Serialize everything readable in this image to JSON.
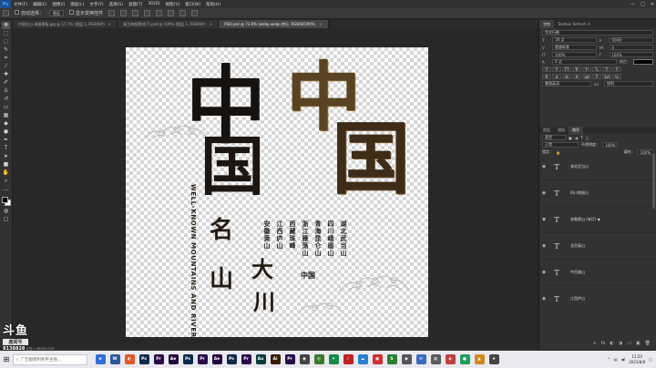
{
  "menubar": {
    "logo": "Ps",
    "items": [
      "文件(F)",
      "编辑(E)",
      "图像(I)",
      "图层(L)",
      "文字(Y)",
      "选择(S)",
      "滤镜(T)",
      "3D(D)",
      "视图(V)",
      "窗口(W)",
      "帮助(H)"
    ],
    "controls": [
      "—",
      "□",
      "✕"
    ]
  },
  "options": {
    "auto_select": "自动选择：",
    "group": "图层",
    "show_transform": "显示变换控件"
  },
  "tabs": [
    {
      "label": "中国名山-海报模板.jpg @ 17.7% (图层 1, RGB/8#)",
      "active": false
    },
    {
      "label": "复古海报素材(7).psd @ 100% (图层 1, RGB/8#)",
      "active": false
    },
    {
      "label": "PSD.psd @ 73.6% (webp.webp 拷贝, RGB/8/CMYK)",
      "active": true
    }
  ],
  "canvas": {
    "zhong_dark": "中",
    "guo_dark": "国",
    "zhong_gold": "中",
    "guo_gold": "国",
    "ming": "名",
    "shan": "山",
    "da": "大",
    "chuan": "川",
    "seal": "中国",
    "english": "WELL-KNOWN MOUNTAINS AND RIVERS",
    "columns": [
      "湖北武当山",
      "四川峨眉山",
      "青海昆仑山",
      "浙江雁荡山",
      "西藏珠峰",
      "江西庐山",
      "安徽黄山"
    ]
  },
  "character_panel": {
    "tabs": [
      "字符",
      "Textbox Refresh 4"
    ],
    "font": "华文行楷",
    "size": "18 点",
    "leading": "(自动)",
    "kerning": "度量标准",
    "tracking": "0",
    "scale_v": "100%",
    "scale_h": "100%",
    "baseline": "0 点",
    "color_label": "颜色：",
    "language": "美国英语",
    "antialias": "锐利",
    "style_buttons": [
      "T",
      "T",
      "TT",
      "Tr",
      "T¹",
      "T₁",
      "T",
      "T"
    ]
  },
  "layers_panel": {
    "tabs": [
      "图层",
      "通道",
      "路径"
    ],
    "kind": "类型",
    "blend": "正常",
    "opacity_label": "不透明度：",
    "opacity": "100%",
    "lock_label": "锁定：",
    "fill_label": "填充：",
    "fill": "100%",
    "layers": [
      {
        "name": "湖北武当山",
        "thumb": "T"
      },
      {
        "name": "四川峨眉山",
        "thumb": "T"
      },
      {
        "name": "安徽黄山 (有灯) ◆",
        "thumb": "T"
      },
      {
        "name": "北岳泰山",
        "thumb": "T"
      },
      {
        "name": "中岳嵩山",
        "thumb": "T"
      },
      {
        "name": "江西庐山",
        "thumb": "T"
      }
    ]
  },
  "status": {
    "text": "73.6%  文档:1.98M/8.07M"
  },
  "taskbar": {
    "search": "广告都想利利平主他...",
    "time": "11:20",
    "date": "2021/8/9",
    "icons": [
      {
        "label": "e",
        "color": "#2f6fd6"
      },
      {
        "label": "W",
        "color": "#2b5797"
      },
      {
        "label": "◐",
        "color": "#e05a2a"
      },
      {
        "label": "Ps",
        "color": "#0b2a4a"
      },
      {
        "label": "Pr",
        "color": "#2a0a4a"
      },
      {
        "label": "Ae",
        "color": "#25083f"
      },
      {
        "label": "Ps",
        "color": "#0b2a4a"
      },
      {
        "label": "Pr",
        "color": "#2a0a4a"
      },
      {
        "label": "Ae",
        "color": "#25083f"
      },
      {
        "label": "Ps",
        "color": "#0b2a4a"
      },
      {
        "label": "Pr",
        "color": "#2a0a4a"
      },
      {
        "label": "Au",
        "color": "#0a3a3a"
      },
      {
        "label": "Ai",
        "color": "#3a1a00"
      },
      {
        "label": "Pr",
        "color": "#2a0a4a"
      },
      {
        "label": "◉",
        "color": "#444"
      },
      {
        "label": "◎",
        "color": "#3d7a2a"
      },
      {
        "label": "✦",
        "color": "#1a8a4a"
      },
      {
        "label": "♪",
        "color": "#c02020"
      },
      {
        "label": "☁",
        "color": "#2a7fd0"
      },
      {
        "label": "▣",
        "color": "#d03030"
      },
      {
        "label": "S",
        "color": "#2e7d32"
      },
      {
        "label": "◆",
        "color": "#555"
      },
      {
        "label": "✉",
        "color": "#3a6bc0"
      },
      {
        "label": "▤",
        "color": "#5a5a5a"
      },
      {
        "label": "◈",
        "color": "#c04040"
      },
      {
        "label": "●",
        "color": "#1f9e5a"
      },
      {
        "label": "▲",
        "color": "#d08a20"
      },
      {
        "label": "★",
        "color": "#444"
      }
    ]
  },
  "watermark": {
    "logo": "斗鱼",
    "sub": "鹿闻号",
    "number": "8138828"
  }
}
